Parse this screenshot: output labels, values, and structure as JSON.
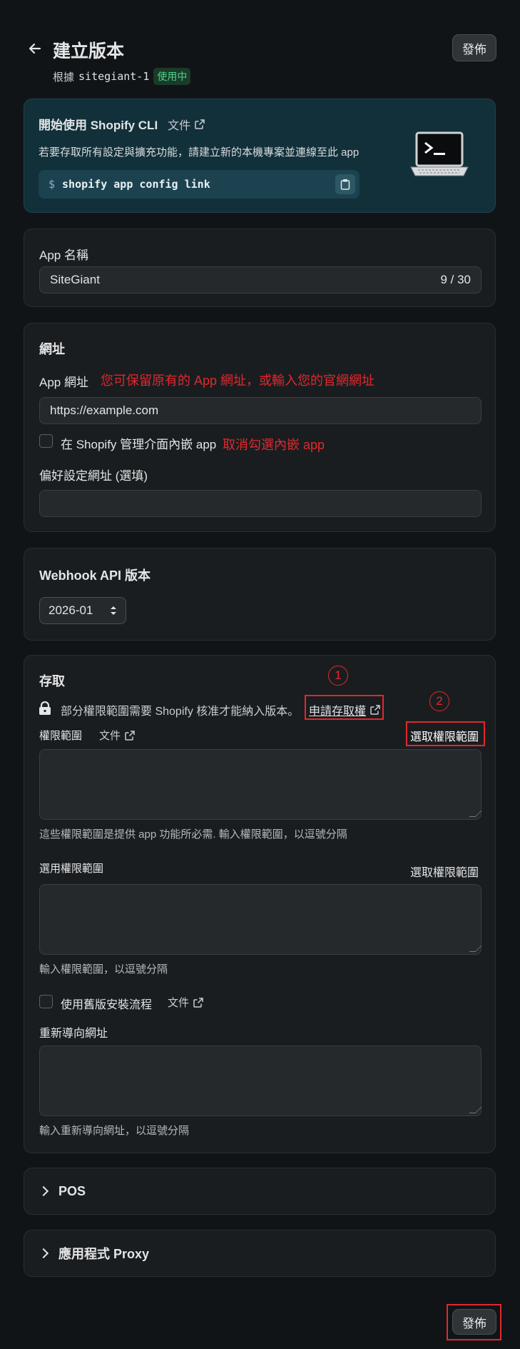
{
  "header": {
    "title": "建立版本",
    "based_on_prefix": "根據",
    "base_version": "sitegiant-1",
    "active_badge": "使用中",
    "publish_label": "發佈"
  },
  "cli": {
    "title": "開始使用 Shopify CLI",
    "doc_link": "文件",
    "description": "若要存取所有設定與擴充功能，請建立新的本機專案並連線至此 app",
    "prompt": "$",
    "command": "shopify app config link"
  },
  "app_name": {
    "label": "App 名稱",
    "value": "SiteGiant",
    "counter": "9 / 30"
  },
  "urls": {
    "title": "網址",
    "app_url_label": "App 網址",
    "app_url_note": "您可保留原有的 App 網址，或輸入您的官網網址",
    "app_url_value": "https://example.com",
    "embed_label": "在 Shopify 管理介面內嵌 app",
    "embed_note": "取消勾選內嵌 app",
    "preferences_label": "偏好設定網址 (選填)",
    "preferences_value": ""
  },
  "webhook": {
    "title": "Webhook API 版本",
    "selected": "2026-01"
  },
  "access": {
    "title": "存取",
    "notice": "部分權限範圍需要 Shopify 核准才能納入版本。",
    "request_link": "申請存取權",
    "scopes_label": "權限範圍",
    "doc_link": "文件",
    "select_scopes": "選取權限範圍",
    "scopes_help": "這些權限範圍是提供 app 功能所必需. 輸入權限範圍，以逗號分隔",
    "optional_scopes_label": "選用權限範圍",
    "optional_select": "選取權限範圍",
    "optional_help": "輸入權限範圍，以逗號分隔",
    "legacy_install_label": "使用舊版安裝流程",
    "legacy_doc_link": "文件",
    "redirect_label": "重新導向網址",
    "redirect_help": "輸入重新導向網址，以逗號分隔",
    "annotation_1": "1",
    "annotation_2": "2"
  },
  "sections": {
    "pos": "POS",
    "proxy": "應用程式 Proxy"
  },
  "footer": {
    "publish_label": "發佈"
  },
  "colors": {
    "background": "#111416",
    "card": "#1a1d1f",
    "cli_card": "#12303a",
    "annotation_red": "#e0282e",
    "badge_green": "#1f8a4c"
  }
}
